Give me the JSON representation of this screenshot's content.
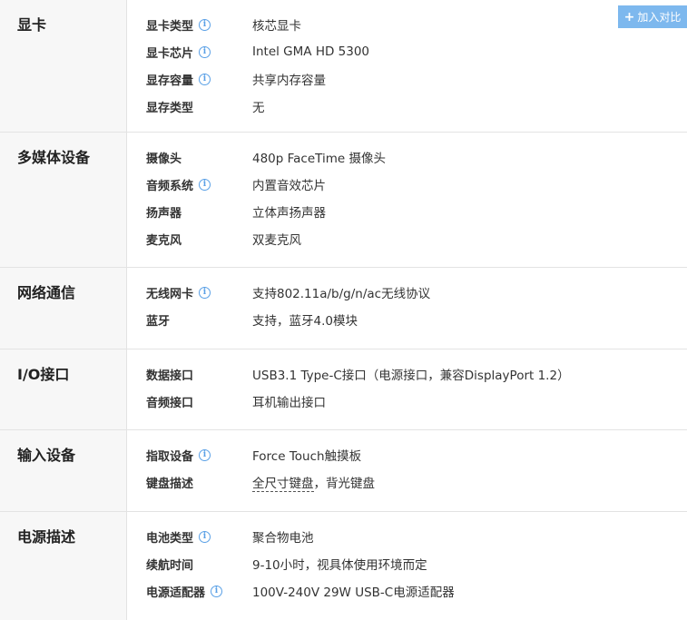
{
  "compare_button": {
    "icon": "plus-icon",
    "label": "加入对比"
  },
  "sections": [
    {
      "title": "显卡",
      "rows": [
        {
          "label": "显卡类型",
          "value": "核芯显卡"
        },
        {
          "label": "显卡芯片",
          "value": "Intel GMA HD 5300"
        },
        {
          "label": "显存容量",
          "value": "共享内存容量"
        },
        {
          "label": "显存类型",
          "value": "无"
        }
      ]
    },
    {
      "title": "多媒体设备",
      "rows": [
        {
          "label": "摄像头",
          "value": "480p FaceTime 摄像头"
        },
        {
          "label": "音频系统",
          "value": "内置音效芯片"
        },
        {
          "label": "扬声器",
          "value": "立体声扬声器"
        },
        {
          "label": "麦克风",
          "value": "双麦克风"
        }
      ]
    },
    {
      "title": "网络通信",
      "rows": [
        {
          "label": "无线网卡",
          "value": "支持802.11a/b/g/n/ac无线协议"
        },
        {
          "label": "蓝牙",
          "value": "支持，蓝牙4.0模块"
        }
      ]
    },
    {
      "title": "I/O接口",
      "rows": [
        {
          "label": "数据接口",
          "value": "USB3.1 Type-C接口（电源接口，兼容DisplayPort 1.2）"
        },
        {
          "label": "音频接口",
          "value": "耳机输出接口"
        }
      ]
    },
    {
      "title": "输入设备",
      "rows": [
        {
          "label": "指取设备",
          "value": "Force Touch触摸板"
        },
        {
          "label": "键盘描述",
          "value_link": "全尺寸键盘",
          "value": "，背光键盘"
        }
      ]
    },
    {
      "title": "电源描述",
      "rows": [
        {
          "label": "电池类型",
          "value": "聚合物电池"
        },
        {
          "label": "续航时间",
          "value": "9-10小时，视具体使用环境而定"
        },
        {
          "label": "电源适配器",
          "value": "100V-240V 29W USB-C电源适配器"
        }
      ]
    }
  ],
  "info_icon": {
    "glyph": "i",
    "color": "#5aa0e6"
  }
}
